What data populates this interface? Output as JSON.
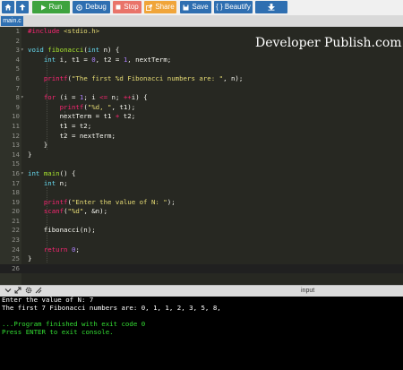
{
  "toolbar": {
    "buttons": [
      {
        "id": "run",
        "label": "Run",
        "color": "#3ea33e",
        "icon": "play-icon"
      },
      {
        "id": "debug",
        "label": "Debug",
        "color": "#2f6fb1",
        "icon": "bug-icon"
      },
      {
        "id": "stop",
        "label": "Stop",
        "color": "#e9746a",
        "icon": "stop-icon"
      },
      {
        "id": "share",
        "label": "Share",
        "color": "#f0a53a",
        "icon": "share-icon"
      },
      {
        "id": "save",
        "label": "Save",
        "color": "#2f6fb1",
        "icon": "floppy-icon"
      },
      {
        "id": "beautify",
        "label": "{ } Beautify",
        "color": "#2f6fb1"
      },
      {
        "id": "download",
        "label": "",
        "color": "#2f6fb1",
        "icon": "download-icon"
      }
    ]
  },
  "tabs": [
    {
      "label": "main.c"
    }
  ],
  "watermark": "Developer Publish.com",
  "editor": {
    "lines": [
      {
        "n": "1",
        "html": "<span class=\"pp\">#include</span> <span class=\"str\">&lt;stdio.h&gt;</span>"
      },
      {
        "n": "2",
        "html": ""
      },
      {
        "n": "3",
        "fold": true,
        "html": "<span class=\"ty\">void</span> <span class=\"fn\">fibonacci</span>(<span class=\"ty\">int</span> n) {"
      },
      {
        "n": "4",
        "html": "    <span class=\"ty\">int</span> i, t1 = <span class=\"num\">0</span>, t2 = <span class=\"num\">1</span>, nextTerm;"
      },
      {
        "n": "5",
        "html": ""
      },
      {
        "n": "6",
        "html": "    <span class=\"pp\">printf</span>(<span class=\"str\">\"The first %d Fibonacci numbers are: \"</span>, n);"
      },
      {
        "n": "7",
        "html": ""
      },
      {
        "n": "8",
        "fold": true,
        "html": "    <span class=\"pp\">for</span> (i = <span class=\"num\">1</span>; i <span class=\"pp\">&lt;=</span> n; <span class=\"pp\">++</span>i) {"
      },
      {
        "n": "9",
        "html": "        <span class=\"pp\">printf</span>(<span class=\"str\">\"%d, \"</span>, t1);"
      },
      {
        "n": "10",
        "html": "        nextTerm = t1 <span class=\"pp\">+</span> t2;"
      },
      {
        "n": "11",
        "html": "        t1 = t2;"
      },
      {
        "n": "12",
        "html": "        t2 = nextTerm;"
      },
      {
        "n": "13",
        "html": "    }"
      },
      {
        "n": "14",
        "html": "}"
      },
      {
        "n": "15",
        "html": ""
      },
      {
        "n": "16",
        "fold": true,
        "html": "<span class=\"ty\">int</span> <span class=\"fn\">main</span>() {"
      },
      {
        "n": "17",
        "html": "    <span class=\"ty\">int</span> n;"
      },
      {
        "n": "18",
        "html": ""
      },
      {
        "n": "19",
        "html": "    <span class=\"pp\">printf</span>(<span class=\"str\">\"Enter the value of N: \"</span>);"
      },
      {
        "n": "20",
        "html": "    <span class=\"pp\">scanf</span>(<span class=\"str\">\"%d\"</span>, &amp;n);"
      },
      {
        "n": "21",
        "html": ""
      },
      {
        "n": "22",
        "html": "    fibonacci(n);"
      },
      {
        "n": "23",
        "html": ""
      },
      {
        "n": "24",
        "html": "    <span class=\"pp\">return</span> <span class=\"num\">0</span>;"
      },
      {
        "n": "25",
        "html": "}"
      },
      {
        "n": "26",
        "html": "",
        "active": true
      }
    ]
  },
  "io": {
    "title": "input",
    "console": [
      {
        "text": "Enter the value of N: 7",
        "color": "#ffffff"
      },
      {
        "text": "The first 7 Fibonacci numbers are: 0, 1, 1, 2, 3, 5, 8,",
        "color": "#ffffff"
      },
      {
        "text": "",
        "color": "#ffffff"
      },
      {
        "text": "...Program finished with exit code 0",
        "color": "#33dd33"
      },
      {
        "text": "Press ENTER to exit console.",
        "color": "#33dd33"
      }
    ]
  }
}
